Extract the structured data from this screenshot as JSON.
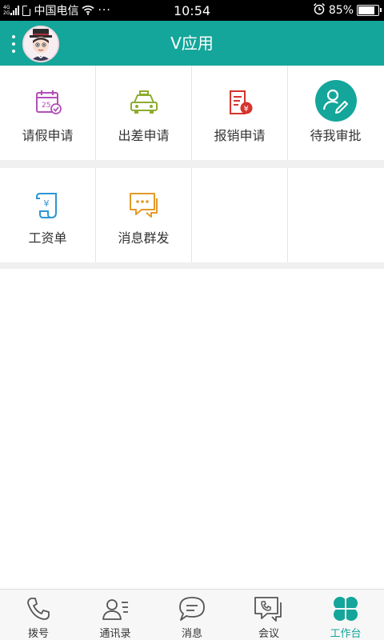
{
  "status_bar": {
    "network_top": "4G",
    "network_bottom": "2G",
    "carrier": "中国电信",
    "more": "···",
    "time": "10:54",
    "battery_percent": "85%",
    "battery_level": 0.85
  },
  "header": {
    "title": "V应用",
    "accent_color": "#14a69a"
  },
  "apps_row1": [
    {
      "label": "请假申请",
      "icon": "calendar-check-icon"
    },
    {
      "label": "出差申请",
      "icon": "taxi-icon"
    },
    {
      "label": "报销申请",
      "icon": "reimbursement-icon"
    },
    {
      "label": "待我审批",
      "icon": "approval-icon"
    }
  ],
  "apps_row2": [
    {
      "label": "工资单",
      "icon": "salary-scroll-icon"
    },
    {
      "label": "消息群发",
      "icon": "broadcast-message-icon"
    }
  ],
  "bottom_nav": [
    {
      "label": "拨号",
      "icon": "phone-icon"
    },
    {
      "label": "通讯录",
      "icon": "contacts-icon"
    },
    {
      "label": "消息",
      "icon": "message-icon"
    },
    {
      "label": "会议",
      "icon": "conference-icon"
    },
    {
      "label": "工作台",
      "icon": "workbench-icon",
      "active": true
    }
  ]
}
